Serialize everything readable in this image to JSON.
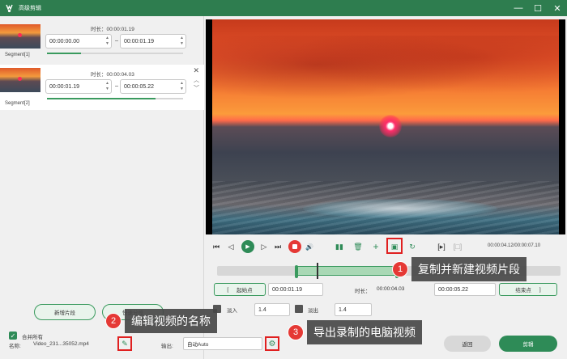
{
  "window": {
    "title": "高级剪辑",
    "icons": [
      "app-logo-icon",
      "minimize-icon",
      "maximize-icon",
      "close-icon"
    ]
  },
  "segments": [
    {
      "label": "Segment[1]",
      "duration": "时长：00:00:01.19",
      "start": "00:00:00.00",
      "end": "00:00:01.19",
      "progress": 0.25
    },
    {
      "label": "Segment[2]",
      "duration": "时长：00:00:04.03",
      "start": "00:00:01.19",
      "end": "00:00:05.22",
      "progress": 0.8
    }
  ],
  "left_buttons": {
    "new_segment": "新增片段",
    "quick_split": "快速分段"
  },
  "merge_all": {
    "label": "合并所有",
    "checked": true
  },
  "player": {
    "timecode": "00:00:04.12/00:00:07.10",
    "icons": [
      "prev-frame-icon",
      "step-back-icon",
      "play-icon",
      "step-forward-icon",
      "next-frame-icon",
      "stop-icon",
      "volume-icon",
      "split-icon",
      "delete-icon",
      "add-icon",
      "copy-new-icon",
      "undo-icon",
      "mark-in-icon",
      "mark-out-icon"
    ]
  },
  "timeline": {
    "selection_start": 0.23,
    "selection_end": 0.53,
    "playhead": 0.29
  },
  "trim": {
    "start_button": "起始点",
    "start_value": "00:00:01.19",
    "duration_label": "时长：",
    "duration_value": "00:00:04.03",
    "end_value": "00:00:05.22",
    "end_button": "结束点"
  },
  "fade": {
    "in_label": "淡入",
    "in_value": "1.4",
    "out_label": "淡出",
    "out_value": "1.4"
  },
  "bottom": {
    "name_label": "名称:",
    "name_value": "Video_231...35052.mp4",
    "output_label": "输出:",
    "output_value": "自动Auto",
    "back_button": "返回",
    "edit_button": "剪辑"
  },
  "callouts": [
    {
      "num": "1",
      "text": "复制并新建视频片段"
    },
    {
      "num": "2",
      "text": "编辑视频的名称"
    },
    {
      "num": "3",
      "text": "导出录制的电脑视频"
    }
  ],
  "colors": {
    "accent": "#2e8b57",
    "title_bar": "#2e7d4f",
    "highlight": "#e02020"
  }
}
